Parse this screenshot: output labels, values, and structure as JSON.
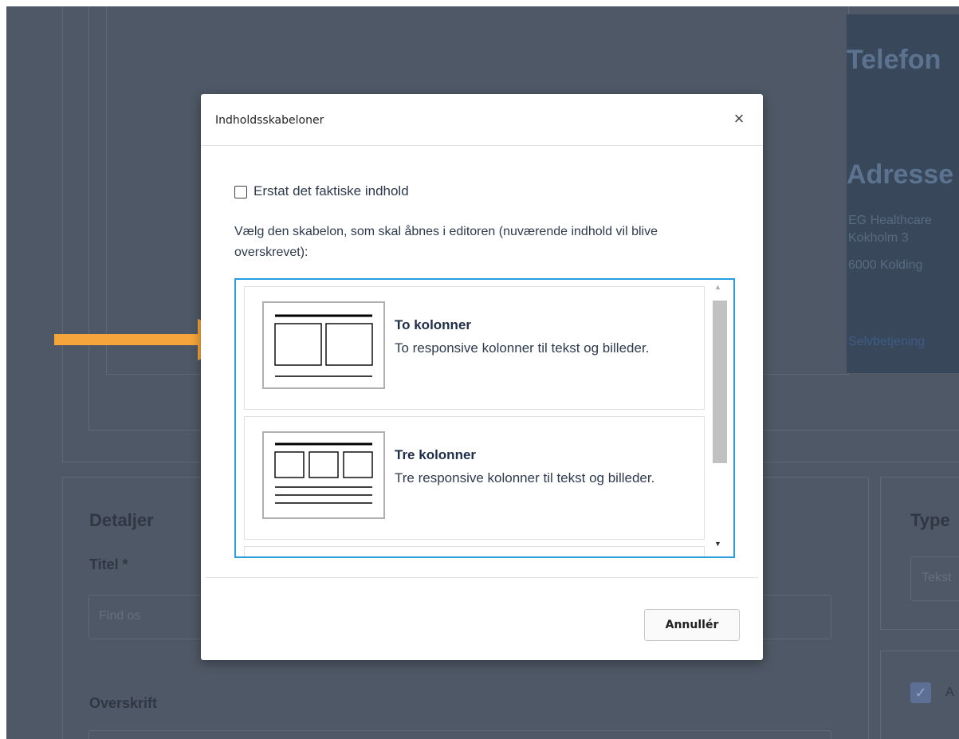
{
  "modal": {
    "title": "Indholdsskabeloner",
    "close_icon": "×",
    "replace_label": "Erstat det faktiske indhold",
    "instruction": "Vælg den skabelon, som skal åbnes i editoren (nuværende indhold vil blive overskrevet):",
    "templates": [
      {
        "title": "To kolonner",
        "description": "To responsive kolonner til tekst og billeder."
      },
      {
        "title": "Tre kolonner",
        "description": "Tre responsive kolonner til tekst og billeder."
      }
    ],
    "cancel_label": "Annullér"
  },
  "background": {
    "phone_heading": "Telefon",
    "address_heading": "Adresse",
    "address_line1": "EG Healthcare",
    "address_line2": "Kokholm 3",
    "address_line3": "6000 Kolding",
    "link": "Selvbetjening",
    "details_heading": "Detaljer",
    "title_label": "Titel *",
    "title_value": "Find os",
    "heading_label": "Overskrift",
    "type_heading": "Type",
    "type_value": "Tekst",
    "checkbox_label": "A"
  },
  "colors": {
    "overlay": "#4f5866",
    "accent_border": "#2a9de0",
    "arrow": "#f5a53a"
  }
}
